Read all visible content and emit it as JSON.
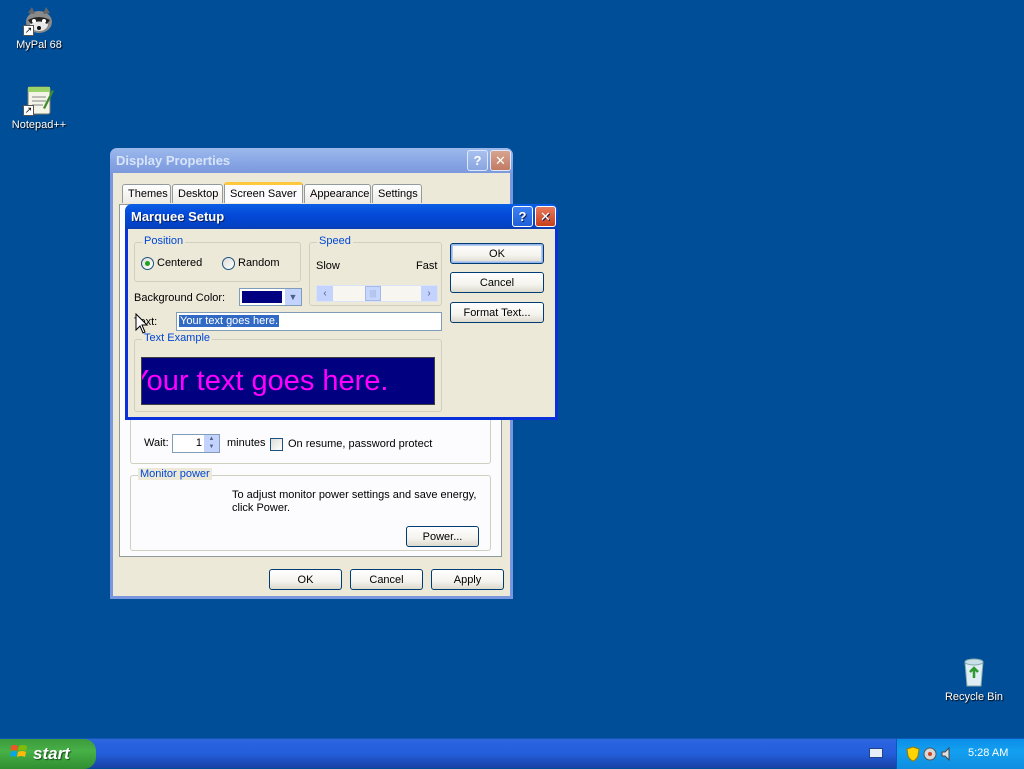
{
  "desktop": {
    "icons": [
      {
        "label": "MyPal 68"
      },
      {
        "label": "Notepad++"
      },
      {
        "label": "Recycle Bin"
      }
    ]
  },
  "display_properties": {
    "title": "Display Properties",
    "tabs": [
      "Themes",
      "Desktop",
      "Screen Saver",
      "Appearance",
      "Settings"
    ],
    "active_tab": "Screen Saver",
    "wait_label": "Wait:",
    "wait_value": "1",
    "minutes_label": "minutes",
    "password_label": "On resume, password protect",
    "password_checked": false,
    "monitor_power": {
      "legend": "Monitor power",
      "text": "To adjust monitor power settings and save energy, click Power.",
      "power_button": "Power..."
    },
    "buttons": {
      "ok": "OK",
      "cancel": "Cancel",
      "apply": "Apply"
    }
  },
  "marquee_setup": {
    "title": "Marquee Setup",
    "position": {
      "legend": "Position",
      "options": [
        "Centered",
        "Random"
      ],
      "selected": "Centered"
    },
    "speed": {
      "legend": "Speed",
      "slow_label": "Slow",
      "fast_label": "Fast",
      "level": 0.43
    },
    "background_color_label": "Background Color:",
    "background_color": "#000080",
    "text_label": "Text:",
    "text_value": "Your text goes here.",
    "text_example": {
      "legend": "Text Example",
      "preview": "Your text goes here.",
      "preview_color": "#ff00ff"
    },
    "buttons": {
      "ok": "OK",
      "cancel": "Cancel",
      "format_text": "Format Text..."
    }
  },
  "taskbar": {
    "start_label": "start",
    "clock": "5:28 AM"
  },
  "colors": {
    "desktop": "#004e98",
    "titlebar_active": "#0449d8",
    "dialog_face": "#ece9d8"
  }
}
